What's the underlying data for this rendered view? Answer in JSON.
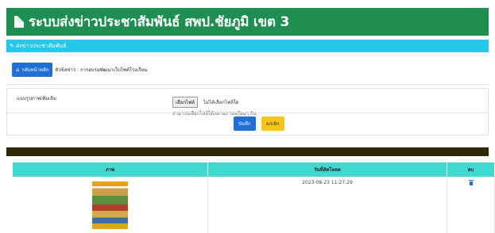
{
  "header": {
    "title": "ระบบส่งข่าวประชาสัมพันธ์ สพป.ชัยภูมิ เขต 3",
    "icon": "document-icon"
  },
  "subheader": {
    "label": "ส่งข่าวประชาสัมพันธ์",
    "icon": "edit-icon"
  },
  "nav": {
    "home_button": "กลับหน้าหลัก",
    "home_icon": "home-icon",
    "topic": "หัวข้อข่าว : การอบรมพัฒนาเว็บไซต์โรงเรียน"
  },
  "form": {
    "label": "แนบรูปภาพเพิ่มเติม",
    "file_button": "เลือกไฟล์",
    "file_status": "ไม่ได้เลือกไฟล์ใด",
    "hint": "สามารถเลือกไฟล์ได้หลายภาพพร้อมๆ กัน",
    "save": "บันทึก",
    "cancel": "ยกเลิก"
  },
  "table": {
    "headers": [
      "ภาพ",
      "วันที่อัพโหลด",
      "ลบ"
    ],
    "rows": [
      {
        "date": "2023-08-23 11:27:29",
        "delete_icon": "trash-icon"
      }
    ]
  },
  "colors": {
    "header": "#1e8f50",
    "subheader": "#23c8ea",
    "primary": "#1f6fd6",
    "warning": "#f5c518",
    "table_head": "#3fd9d0"
  }
}
